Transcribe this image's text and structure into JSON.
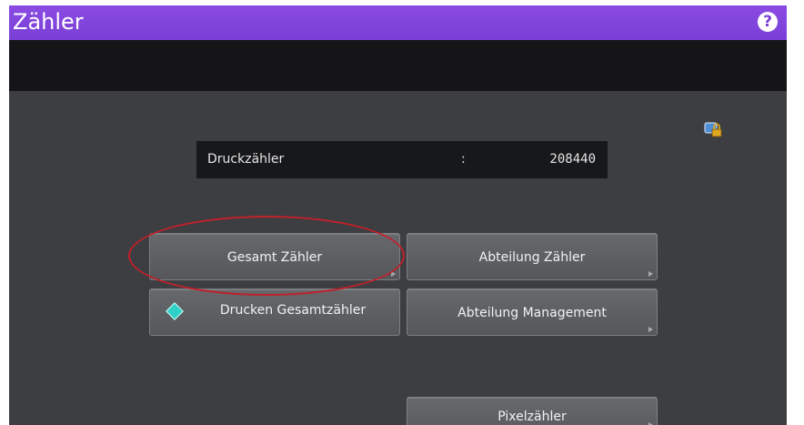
{
  "header": {
    "title": "Zähler",
    "help_glyph": "?"
  },
  "counter": {
    "label": "Druckzähler",
    "separator": ":",
    "value": "208440"
  },
  "buttons": {
    "total_counter": "Gesamt Zähler",
    "department_counter": "Abteilung Zähler",
    "print_total": "Drucken Gesamtzähler",
    "department_management": "Abteilung Management",
    "pixel_counter": "Pixelzähler"
  },
  "icons": {
    "help": "help-icon",
    "lock": "lock-icon",
    "print_start": "diamond-start-icon"
  },
  "colors": {
    "titlebar": "#7a3fd6",
    "screen_background": "#3c3e42",
    "highlight_ellipse": "#c0202a",
    "start_icon": "#2ed0c8"
  }
}
